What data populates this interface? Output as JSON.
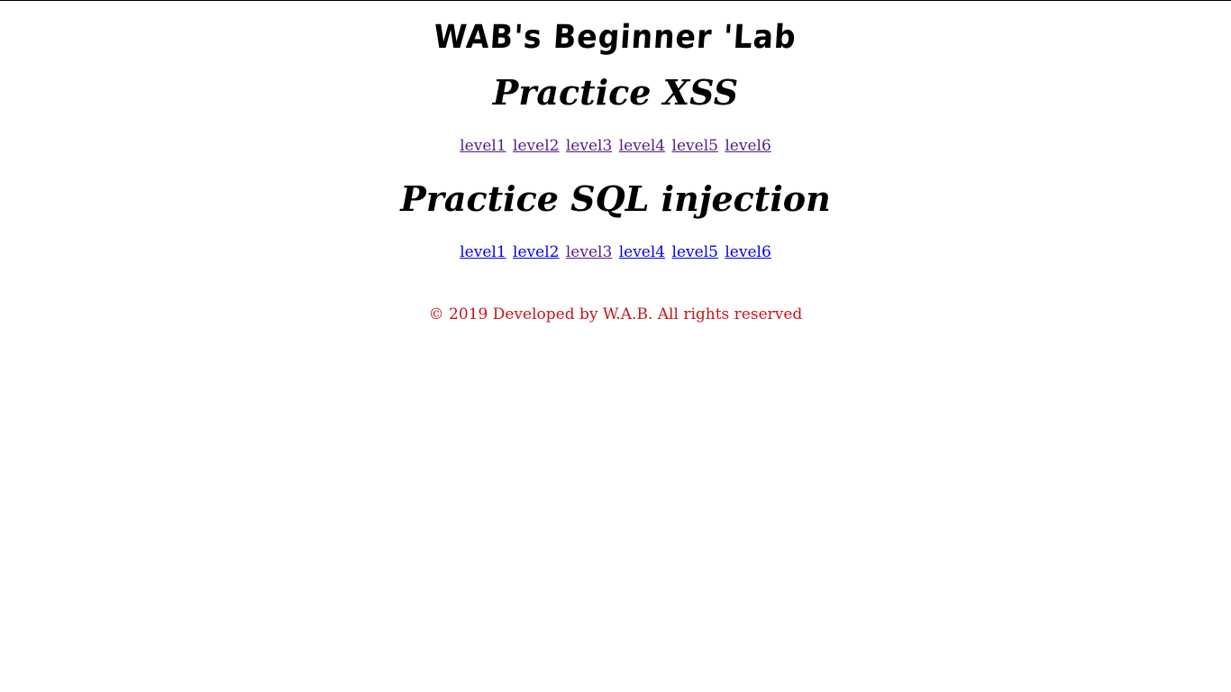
{
  "header": {
    "site_title": "WAB's Beginner 'Lab"
  },
  "xss": {
    "heading": "Practice XSS",
    "levels": [
      "level1",
      "level2",
      "level3",
      "level4",
      "level5",
      "level6"
    ]
  },
  "sql": {
    "heading": "Practice SQL injection",
    "levels": [
      "level1",
      "level2",
      "level3",
      "level4",
      "level5",
      "level6"
    ]
  },
  "footer": {
    "text": "© 2019 Developed by W.A.B. All rights reserved"
  },
  "colors": {
    "visited_link": "#551a8b",
    "unvisited_link": "#0000ee",
    "footer_text": "#c4161c"
  }
}
